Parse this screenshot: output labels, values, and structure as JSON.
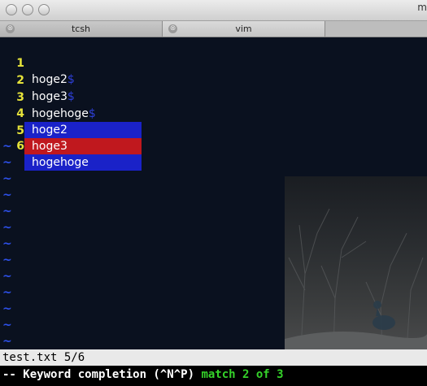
{
  "window": {
    "title_fragment": "m"
  },
  "tabs": [
    {
      "label": "tcsh",
      "close": "⊗"
    },
    {
      "label": "vim",
      "close": "⊗"
    }
  ],
  "editor": {
    "lines": [
      {
        "num": "1",
        "text": "hoge2",
        "eol": "$"
      },
      {
        "num": "2",
        "text": "hoge3",
        "eol": "$"
      },
      {
        "num": "3",
        "text": "hogehoge",
        "eol": "$"
      },
      {
        "num": "4",
        "text": "",
        "eol": "$"
      },
      {
        "num": "5",
        "text": "ho",
        "eol": ""
      },
      {
        "num": "6",
        "text": "",
        "eol": ""
      }
    ],
    "tilde": "~"
  },
  "completion_menu": {
    "items": [
      "hoge2",
      "hoge3",
      "hogehoge"
    ],
    "selected_index": 1
  },
  "statusline": {
    "text": "test.txt 5/6"
  },
  "cmdline": {
    "mode_text": "-- Keyword completion (^N^P) ",
    "match_text": "match 2 of 3"
  },
  "colors": {
    "background": "#0a111f",
    "line_number": "#e6e33a",
    "eol_marker": "#2d3fd6",
    "popup_bg": "#1a22c8",
    "popup_selected": "#c0181e",
    "match_text": "#35d22a"
  }
}
